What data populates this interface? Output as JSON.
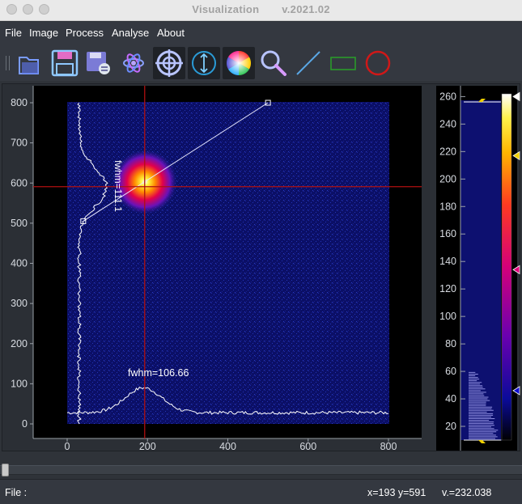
{
  "window": {
    "title": "Visualization",
    "version": "v.2021.02"
  },
  "menu": [
    "File",
    "Image",
    "Process",
    "Analyse",
    "About"
  ],
  "toolbar": {
    "tools": [
      "open-folder",
      "save",
      "save-as",
      "settings-atom",
      "crosshair-target",
      "vertical-profile",
      "color-wheel",
      "zoom",
      "line-tool",
      "rectangle-tool",
      "circle-tool"
    ],
    "active": [
      "crosshair-target",
      "vertical-profile",
      "color-wheel"
    ]
  },
  "colors": {
    "accent": "#d01818",
    "image_background": "#0a0a5a",
    "profile": "#ffffff",
    "cursor": "#b01010"
  },
  "image_plot": {
    "x_ticks": [
      "0",
      "200",
      "400",
      "600",
      "800"
    ],
    "y_ticks": [
      "0",
      "100",
      "200",
      "300",
      "400",
      "500",
      "600",
      "700",
      "800"
    ],
    "fwhm_x_label": "fwhm=106.66",
    "fwhm_y_label": "fwhm=111.1",
    "cursor": {
      "x": 193,
      "y": 591
    },
    "line_roi": {
      "x1": 40,
      "y1": 505,
      "x2": 500,
      "y2": 800
    }
  },
  "colorbar": {
    "ticks": [
      "20",
      "40",
      "60",
      "80",
      "100",
      "120",
      "140",
      "160",
      "180",
      "200",
      "220",
      "240",
      "260"
    ],
    "range": [
      10,
      262
    ]
  },
  "status": {
    "file_label": "File :",
    "coords": "x=193 y=591",
    "value": "v.=232.038"
  },
  "slider": {
    "position": 0.0
  }
}
